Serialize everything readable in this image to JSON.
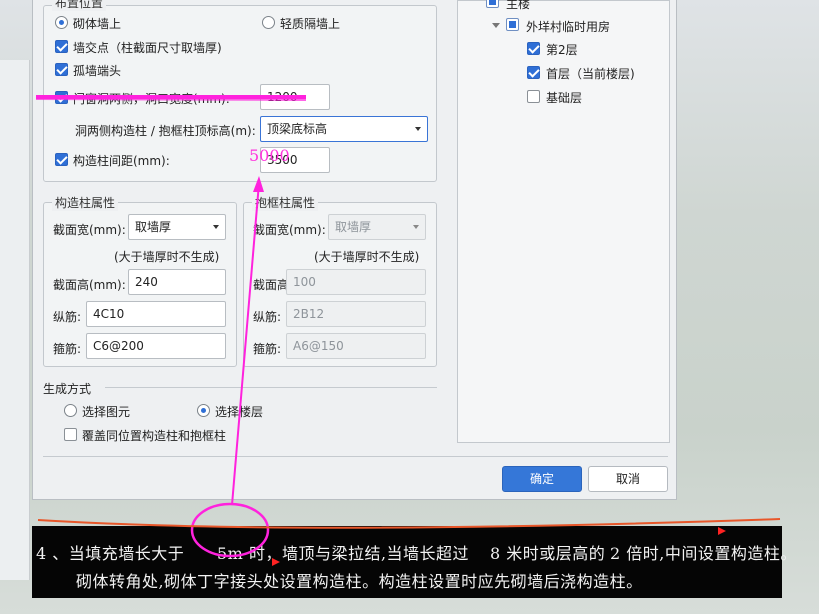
{
  "dialog": {
    "layout_group": {
      "title": "布置位置",
      "radio_masonry": "砌体墙上",
      "radio_light": "轻质隔墙上",
      "chk_wall_intersection": "墙交点（柱截面尺寸取墙厚)",
      "chk_isolated_end": "孤墙端头",
      "chk_door_window": "门窗洞两侧，洞口宽度(mm):",
      "door_width_value": "1200",
      "top_height_label": "洞两侧构造柱 / 抱框柱顶标高(m):",
      "top_height_value": "顶梁底标高",
      "chk_spacing": "构造柱间距(mm):",
      "spacing_value": "3500"
    },
    "column_props": {
      "title": "构造柱属性",
      "width_label": "截面宽(mm):",
      "width_value": "取墙厚",
      "note": "(大于墙厚时不生成)",
      "height_label": "截面高(mm):",
      "height_value": "240",
      "long_rebar_label": "纵筋:",
      "long_rebar_value": "4C10",
      "stirrup_label": "箍筋:",
      "stirrup_value": "C6@200"
    },
    "frame_props": {
      "title": "抱框柱属性",
      "width_label": "截面宽(mm):",
      "width_value": "取墙厚",
      "note": "(大于墙厚时不生成)",
      "height_label": "截面高(mm):",
      "height_value": "100",
      "long_rebar_label": "纵筋:",
      "long_rebar_value": "2B12",
      "stirrup_label": "箍筋:",
      "stirrup_value": "A6@150"
    },
    "generate": {
      "title": "生成方式",
      "radio_select_element": "选择图元",
      "radio_select_floor": "选择楼层",
      "chk_overwrite": "覆盖同位置构造柱和抱框柱"
    },
    "tree": {
      "root": "主楼",
      "node": "外垟村临时用房",
      "floors": [
        {
          "label": "第2层",
          "checked": true
        },
        {
          "label": "首层（当前楼层)",
          "checked": true
        },
        {
          "label": "基础层",
          "checked": false
        }
      ]
    },
    "ok_label": "确定",
    "cancel_label": "取消"
  },
  "annotation": {
    "handwritten_value": "5000",
    "color": "#ff33dd"
  },
  "caption": {
    "line1_a": "4 、当填充墙长大于",
    "line1_b": "5m 时，墙顶与梁拉结,当墙长超过",
    "line1_c": "8 米时或层高的",
    "line1_d": "2 倍时,中间设置构造柱。",
    "line2": "砌体转角处,砌体丁字接头处设置构造柱。构造柱设置时应先砌墙后浇构造柱。"
  }
}
